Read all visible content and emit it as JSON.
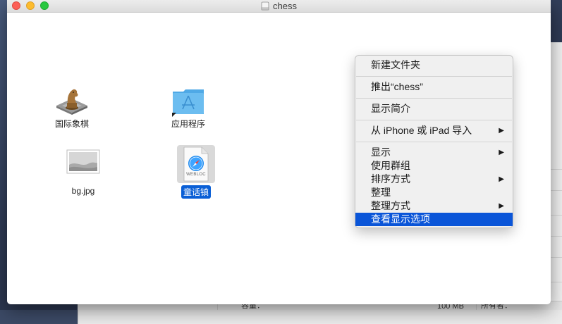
{
  "window": {
    "title": "chess"
  },
  "icons": [
    {
      "label": "国际象棋",
      "icon": "chess-knight-icon",
      "selected": false
    },
    {
      "label": "应用程序",
      "icon": "applications-folder-icon",
      "selected": false
    },
    {
      "label": "bg.jpg",
      "icon": "image-file-icon",
      "selected": false
    },
    {
      "label": "童话镇",
      "icon": "webloc-file-icon",
      "badge": "WEBLOC",
      "selected": true
    }
  ],
  "context_menu": {
    "items": [
      {
        "label": "新建文件夹"
      },
      {
        "label": "推出“chess”"
      },
      {
        "label": "显示简介"
      },
      {
        "label": "从 iPhone 或 iPad 导入",
        "submenu": true
      },
      {
        "label": "显示",
        "submenu": true
      },
      {
        "label": "使用群组"
      },
      {
        "label": "排序方式",
        "submenu": true
      },
      {
        "label": "整理"
      },
      {
        "label": "整理方式",
        "submenu": true
      },
      {
        "label": "查看显示选项",
        "highlighted": true
      }
    ],
    "arrow": "▶"
  },
  "background_window": {
    "capacity_label": "容量：",
    "capacity_value": "100 MB",
    "owner_label": "所有者："
  },
  "colors": {
    "selection": "#0a5fd6",
    "menu_highlight": "#0a55d8",
    "close": "#fc5f57",
    "minimize": "#fdbc2e",
    "maximize": "#28c840"
  }
}
